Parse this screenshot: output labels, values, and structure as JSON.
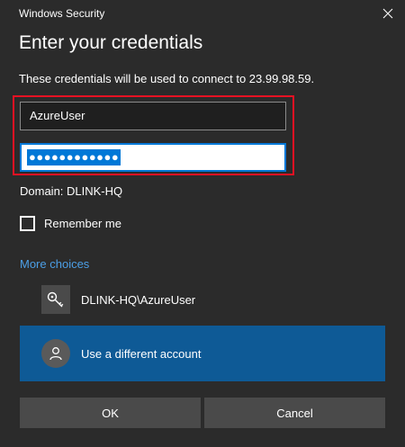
{
  "window": {
    "title": "Windows Security"
  },
  "dialog": {
    "heading": "Enter your credentials",
    "description": "These credentials will be used to connect to 23.99.98.59."
  },
  "fields": {
    "username_value": "AzureUser",
    "password_mask": "●●●●●●●●●●●●"
  },
  "domain_text": "Domain: DLINK-HQ",
  "remember": {
    "label": "Remember me",
    "checked": false
  },
  "more_choices": "More choices",
  "accounts": [
    {
      "label": "DLINK-HQ\\AzureUser",
      "icon": "key-icon",
      "selected": false
    },
    {
      "label": "Use a different account",
      "icon": "user-icon",
      "selected": true
    }
  ],
  "buttons": {
    "ok": "OK",
    "cancel": "Cancel"
  },
  "colors": {
    "background": "#2b2b2b",
    "accent_blue": "#0078d7",
    "selected_row": "#0e5a96",
    "link_blue": "#4c9fe6",
    "highlight_red": "#e81123",
    "button_gray": "#4a4a4a"
  }
}
